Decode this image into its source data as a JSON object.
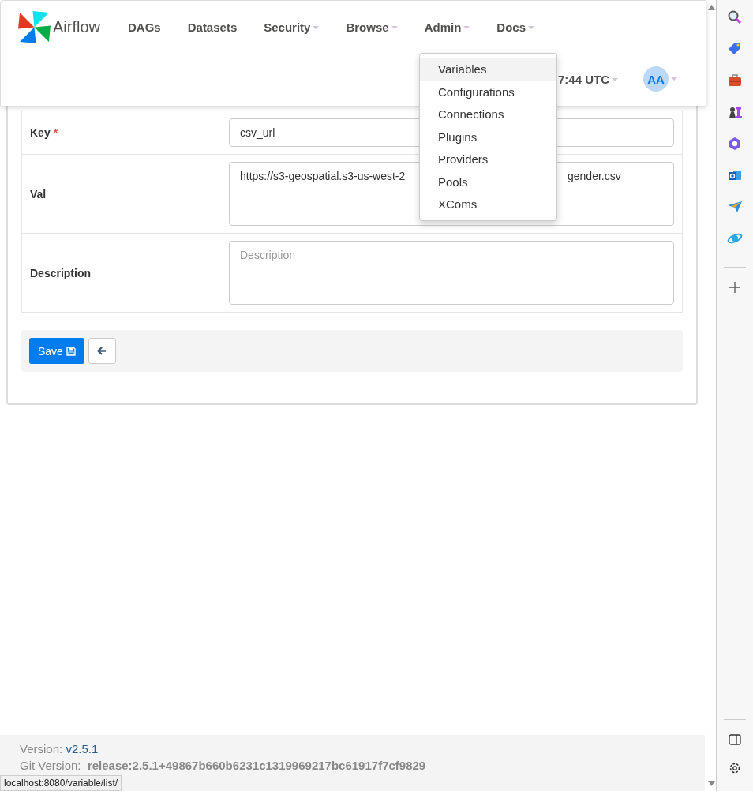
{
  "navbar": {
    "brand": "Airflow",
    "menus": [
      {
        "label": "DAGs",
        "has_caret": false
      },
      {
        "label": "Datasets",
        "has_caret": false
      },
      {
        "label": "Security",
        "has_caret": true
      },
      {
        "label": "Browse",
        "has_caret": true
      },
      {
        "label": "Admin",
        "has_caret": true
      },
      {
        "label": "Docs",
        "has_caret": true
      }
    ],
    "time": "7:44 UTC",
    "user_initials": "AA"
  },
  "dropdown": {
    "items": [
      {
        "label": "Variables",
        "selected": true
      },
      {
        "label": "Configurations",
        "selected": false
      },
      {
        "label": "Connections",
        "selected": false
      },
      {
        "label": "Plugins",
        "selected": false
      },
      {
        "label": "Providers",
        "selected": false
      },
      {
        "label": "Pools",
        "selected": false
      },
      {
        "label": "XComs",
        "selected": false
      }
    ]
  },
  "form": {
    "fields": [
      {
        "kind": "input",
        "label": "Key",
        "required_mark": "*",
        "value": "csv_url"
      },
      {
        "kind": "textarea",
        "label": "Val",
        "value_parts": [
          "https://s3-geospatial.s3-us-west-2",
          "gender.csv"
        ]
      },
      {
        "kind": "textarea",
        "label": "Description",
        "placeholder": "Description"
      }
    ],
    "save_label": "Save"
  },
  "footer": {
    "version_label": "Version:",
    "version": "v2.5.1",
    "git_label": "Git Version:",
    "git_value": "release:2.5.1+49867b660b6231c1319969217bc61917f7cf9829"
  },
  "status_url": "localhost:8080/variable/list/"
}
